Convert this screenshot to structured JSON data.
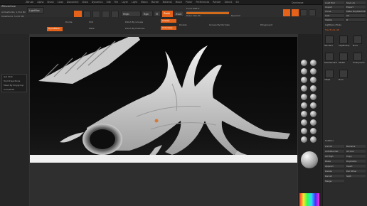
{
  "menubar": {
    "items": [
      "ZBrush",
      "Alpha",
      "Brush",
      "Color",
      "Document",
      "Draw",
      "Dynamics",
      "Edit",
      "File",
      "Layer",
      "Light",
      "Macro",
      "Marker",
      "Material",
      "Movie",
      "Picker",
      "Preferences",
      "Render",
      "Stencil",
      "Stroke",
      "Texture",
      "Tool",
      "Transform",
      "Zplugin",
      "Zscript"
    ],
    "right_label": "Quicksave"
  },
  "top": {
    "ztitle": "ZBrushCore",
    "lightbox": "LightBox",
    "focal": "Focal Shift 0",
    "drawsize": "Draw Size 64",
    "dynamic": "Dynamic",
    "activepoints": "ActivePoints: 1.314 Mil",
    "totalpoints": "TotalPoints: 5.247 Mil",
    "mrgb": "Mrgb",
    "rgb": "Rgb",
    "m": "M",
    "zadd": "Zadd",
    "zsub": "Zsub",
    "zint_label": "Z Intensity 25",
    "rgb_int_label": "Rgb Intensity 100",
    "persp": "Persp",
    "floor": "Floor",
    "local": "Local",
    "xyz": "Xyz",
    "frame": "Frame",
    "move": "Move",
    "scale": "Scale",
    "rotate": "Rotate",
    "polyf": "PolyF",
    "transp": "Transp"
  },
  "subtool_row": {
    "mask_by_polygroups": "Mask By Polygroups 0",
    "backface": "BackfaceMask",
    "auto_groups": "Auto Groups",
    "groups_split": "Groups Split",
    "del_hidden": "Del Hidden",
    "mirror_and_weld": "Mirror And Weld",
    "close_holes": "Close Holes",
    "polish_groups": "Polish By Groups",
    "polish_features": "Polish By Features",
    "crease": "Crease",
    "uncrease": "UnCrease",
    "double": "Double",
    "groups_by_normals": "Groups By Normals",
    "polygroupit": "Polygroupit",
    "divide": "Divide",
    "smooth": "Smt",
    "mask": "Mask",
    "dynamesh": "DynaMesh"
  },
  "left": {
    "items": [
      "Gel Shdr",
      "Tool Projections",
      "Mask By Polygroup",
      "ActiveEdit"
    ]
  },
  "right": {
    "top_labels": [
      "Load Tool",
      "Save As",
      "Import",
      "Export",
      "Clone",
      "Make PolyMesh3D",
      "GoZ",
      "All",
      "Visible",
      "R"
    ],
    "lightbox_tools": "Lightbox>Tools",
    "tool_name": "TreeTrunk_48",
    "brush_labels": [
      "Standard",
      "ClayBuildup",
      "Move",
      "DamStandard",
      "hPolish",
      "TrimDynamic",
      "Inflate",
      "Pinch"
    ],
    "subtool": "SubTool",
    "list_all": "List All",
    "rename": "Rename",
    "autoreorder": "AutoReorder",
    "all_low": "All Low",
    "all_high": "All High",
    "copy": "Copy",
    "paste": "Paste",
    "duplicate": "Duplicate",
    "append": "Append",
    "insert": "Insert",
    "delete": "Delete",
    "del_other": "Del Other",
    "del_all": "Del All",
    "split": "Split",
    "merge": "Merge"
  },
  "shelf": {
    "label_a": "Ltool",
    "label_b": "Scroll"
  },
  "colors": {
    "accent": "#e4621a",
    "viewport_bg": "#0a0a0a",
    "sculpt": "#d9d9d9"
  }
}
